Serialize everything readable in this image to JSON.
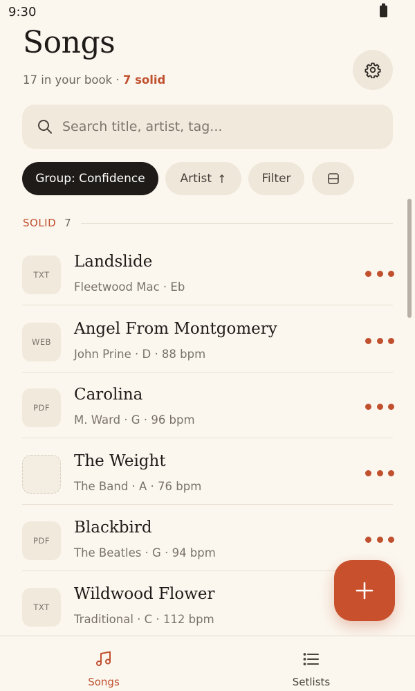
{
  "status_bar": {
    "time": "9:30"
  },
  "header": {
    "title": "Songs",
    "subtitle_count": "17 in your book",
    "subtitle_sep": " · ",
    "subtitle_solid": "7 solid"
  },
  "search": {
    "placeholder": "Search title, artist, tag..."
  },
  "chips": {
    "group": "Group: Confidence",
    "sort": "Artist",
    "sort_arrow": "↑",
    "filter": "Filter"
  },
  "section": {
    "label": "SOLID",
    "count": "7"
  },
  "songs": [
    {
      "title": "Landslide",
      "meta": "Fleetwood Mac · Eb",
      "type": "TXT"
    },
    {
      "title": "Angel From Montgomery",
      "meta": "John Prine · D · 88 bpm",
      "type": "WEB"
    },
    {
      "title": "Carolina",
      "meta": "M. Ward · G · 96 bpm",
      "type": "PDF"
    },
    {
      "title": "The Weight",
      "meta": "The Band · A · 76 bpm",
      "type": ""
    },
    {
      "title": "Blackbird",
      "meta": "The Beatles · G · 94 bpm",
      "type": "PDF"
    },
    {
      "title": "Wildwood Flower",
      "meta": "Traditional · C · 112 bpm",
      "type": "TXT"
    }
  ],
  "nav": {
    "songs": "Songs",
    "setlists": "Setlists",
    "active": "songs"
  },
  "icons": {
    "settings": "gear-icon",
    "search": "search-icon",
    "layout": "layout-toggle-icon",
    "more": "more-dots-icon",
    "add": "plus-icon",
    "songs": "music-note-icon",
    "setlists": "list-icon"
  },
  "colors": {
    "accent": "#c0502e",
    "background": "#fbf7ef",
    "chip_active": "#1f1b18",
    "fab": "#c9502d"
  }
}
